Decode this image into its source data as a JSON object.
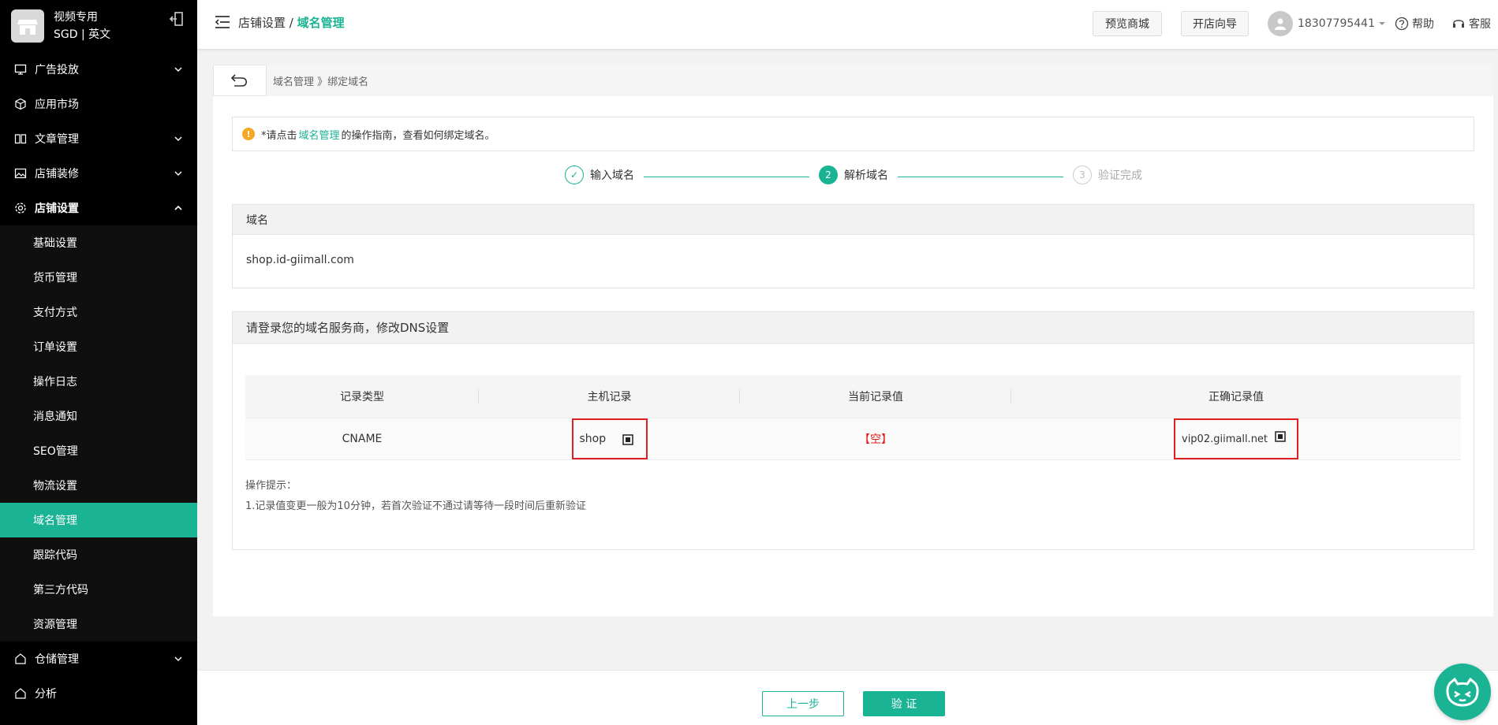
{
  "store": {
    "name": "视频专用",
    "region": "SGD | 英文"
  },
  "sidebar": {
    "items": [
      {
        "label": "广告投放",
        "icon": "monitor-icon",
        "has_children": true
      },
      {
        "label": "应用市场",
        "icon": "cube-icon",
        "has_children": false
      },
      {
        "label": "文章管理",
        "icon": "book-icon",
        "has_children": true
      },
      {
        "label": "店铺装修",
        "icon": "image-icon",
        "has_children": true
      },
      {
        "label": "店铺设置",
        "icon": "gear-icon",
        "has_children": true,
        "open": true
      }
    ],
    "sub_items": [
      {
        "label": "基础设置"
      },
      {
        "label": "货币管理"
      },
      {
        "label": "支付方式"
      },
      {
        "label": "订单设置"
      },
      {
        "label": "操作日志"
      },
      {
        "label": "消息通知"
      },
      {
        "label": "SEO管理"
      },
      {
        "label": "物流设置"
      },
      {
        "label": "域名管理",
        "active": true
      },
      {
        "label": "跟踪代码"
      },
      {
        "label": "第三方代码"
      },
      {
        "label": "资源管理"
      }
    ],
    "bottom_items": [
      {
        "label": "仓储管理",
        "icon": "home-icon",
        "has_children": true
      },
      {
        "label": "分析",
        "icon": "home-icon",
        "has_children": false
      }
    ]
  },
  "header": {
    "breadcrumb_parent": "店铺设置 /",
    "breadcrumb_current": "域名管理",
    "preview_label": "预览商城",
    "guide_label": "开店向导",
    "user_phone": "18307795441",
    "help_label": "帮助",
    "service_label": "客服"
  },
  "subcrumb": "域名管理 》绑定域名",
  "notice": {
    "prefix": "*请点击",
    "link": "域名管理",
    "suffix": "的操作指南，查看如何绑定域名。"
  },
  "steps": [
    {
      "num": "✓",
      "label": "输入域名",
      "state": "done"
    },
    {
      "num": "2",
      "label": "解析域名",
      "state": "active"
    },
    {
      "num": "3",
      "label": "验证完成",
      "state": "todo"
    }
  ],
  "domain_box": {
    "title": "域名",
    "value": "shop.id-giimall.com"
  },
  "dns_box": {
    "title": "请登录您的域名服务商，修改DNS设置",
    "columns": [
      "记录类型",
      "主机记录",
      "当前记录值",
      "正确记录值"
    ],
    "row": {
      "type": "CNAME",
      "host": "shop",
      "current": "【空】",
      "correct": "vip02.giimall.net"
    },
    "tips_title": "操作提示：",
    "tips_line": "1.记录值变更一般为10分钟，若首次验证不通过请等待一段时间后重新验证"
  },
  "footer": {
    "prev_label": "上一步",
    "verify_label": "验 证"
  },
  "colors": {
    "accent": "#1ab394",
    "highlight": "#e02020",
    "sidebar_bg": "#000000"
  }
}
